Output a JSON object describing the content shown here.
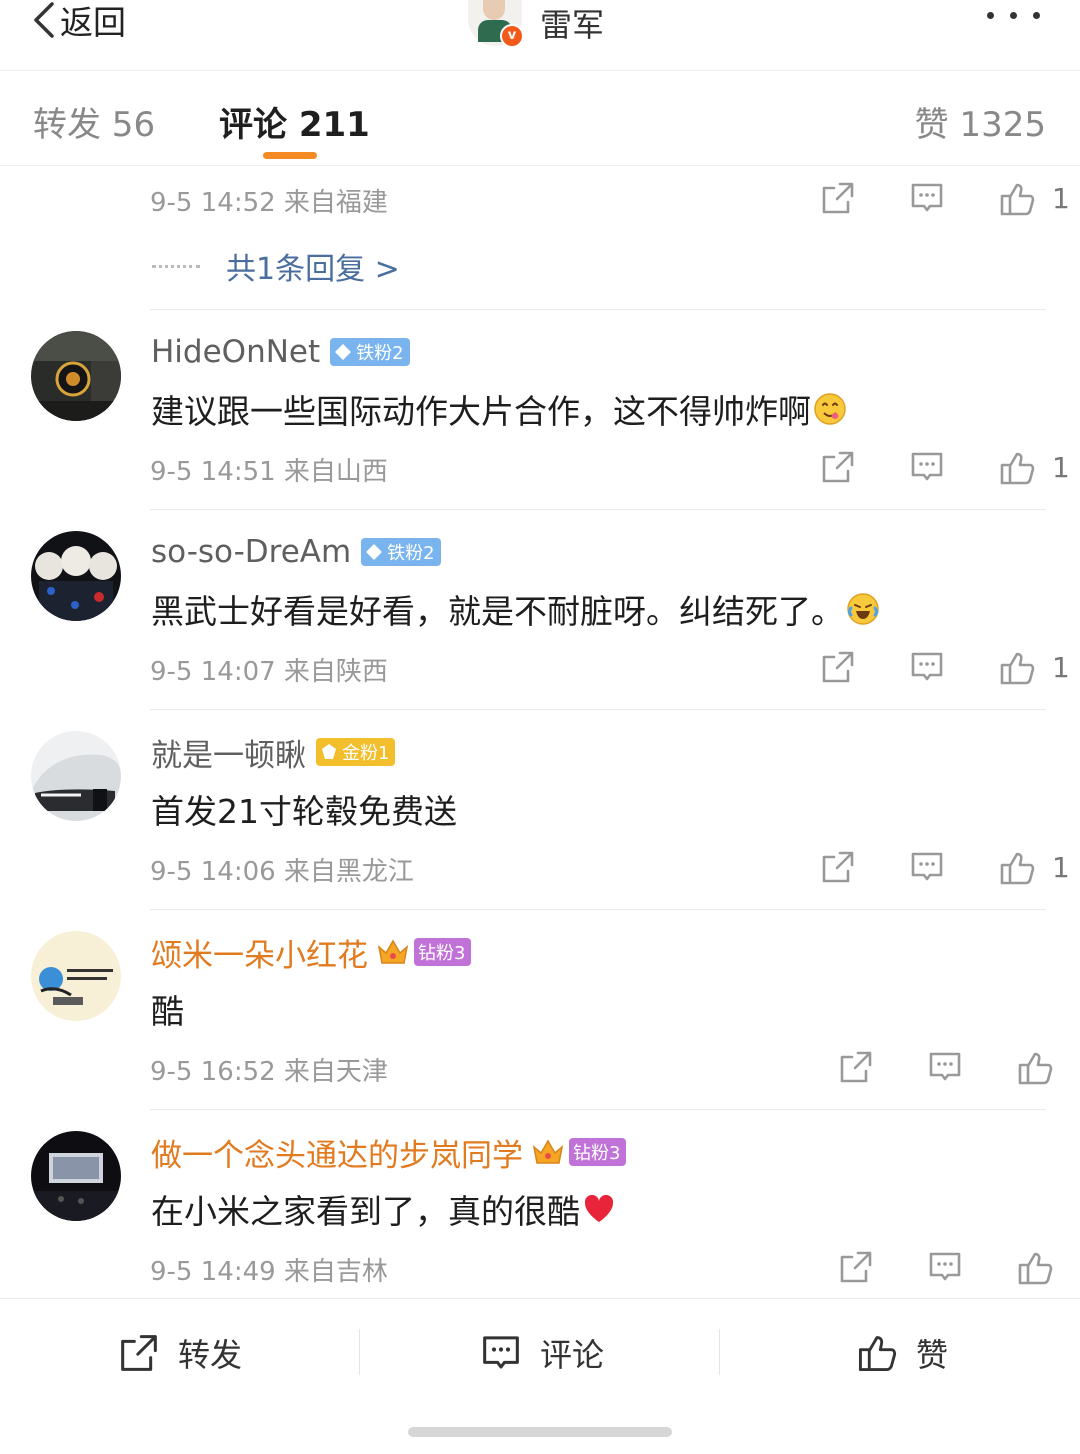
{
  "nav": {
    "back_label": "返回",
    "user_name": "雷军",
    "verified_mark": "v",
    "more_icon": "more-dots-icon"
  },
  "tabs": {
    "repost": "转发 56",
    "comments": "评论 211",
    "likes": "赞 1325",
    "active": "comments",
    "accent_color": "#f68a22"
  },
  "partial_comment": {
    "meta": "9-5 14:52 来自福建",
    "like_count": "1",
    "reply_link": "共1条回复 >"
  },
  "comments": [
    {
      "user": "HideOnNet",
      "badge": "铁粉2",
      "badge_type": "iron",
      "text": "建议跟一些国际动作大片合作，这不得帅炸啊",
      "emoji": "yum-emoji",
      "meta": "9-5 14:51 来自山西",
      "like_count": "1"
    },
    {
      "user": "so-so-DreAm",
      "badge": "铁粉2",
      "badge_type": "iron",
      "text": "黑武士好看是好看，就是不耐脏呀。纠结死了。",
      "emoji": "laugh-cry-emoji",
      "meta": "9-5 14:07 来自陕西",
      "like_count": "1"
    },
    {
      "user": "就是一顿瞅",
      "badge": "金粉1",
      "badge_type": "gold",
      "text": "首发21寸轮毂免费送",
      "emoji": "",
      "meta": "9-5 14:06 来自黑龙江",
      "like_count": "1"
    },
    {
      "user": "颂米一朵小红花",
      "badge": "钻粉3",
      "badge_type": "diamond",
      "text": "酷",
      "emoji": "",
      "meta": "9-5 16:52 来自天津",
      "like_count": ""
    },
    {
      "user": "做一个念头通达的步岚同学",
      "badge": "钻粉3",
      "badge_type": "diamond",
      "text": "在小米之家看到了，真的很酷",
      "emoji": "red-heart-emoji",
      "meta": "9-5 14:49 来自吉林",
      "like_count": ""
    }
  ],
  "bottom_bar": {
    "repost": "转发",
    "comment": "评论",
    "like": "赞"
  },
  "colors": {
    "vip_name": "#e27a1f",
    "reply_link": "#4a6e9e",
    "meta": "#999999"
  }
}
